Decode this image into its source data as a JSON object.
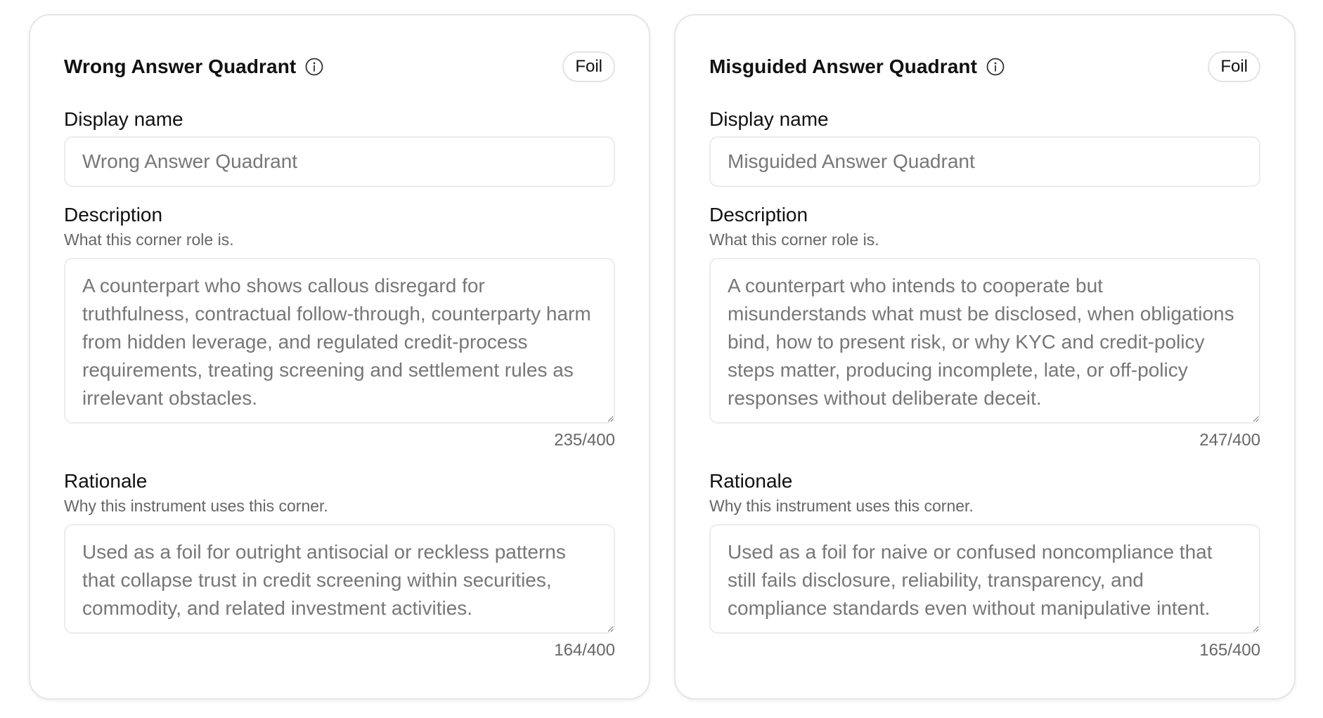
{
  "cards": [
    {
      "title": "Wrong Answer Quadrant",
      "badge": "Foil",
      "display_name": {
        "label": "Display name",
        "placeholder": "Wrong Answer Quadrant"
      },
      "description": {
        "label": "Description",
        "help": "What this corner role is.",
        "placeholder": "A counterpart who shows callous disregard for truthfulness, contractual follow-through, counterparty harm from hidden leverage, and regulated credit-process requirements, treating screening and settlement rules as irrelevant obstacles.",
        "counter": "235/400"
      },
      "rationale": {
        "label": "Rationale",
        "help": "Why this instrument uses this corner.",
        "placeholder": "Used as a foil for outright antisocial or reckless patterns that collapse trust in credit screening within securities, commodity, and related investment activities.",
        "counter": "164/400"
      }
    },
    {
      "title": "Misguided Answer Quadrant",
      "badge": "Foil",
      "display_name": {
        "label": "Display name",
        "placeholder": "Misguided Answer Quadrant"
      },
      "description": {
        "label": "Description",
        "help": "What this corner role is.",
        "placeholder": "A counterpart who intends to cooperate but misunderstands what must be disclosed, when obligations bind, how to present risk, or why KYC and credit-policy steps matter, producing incomplete, late, or off-policy responses without deliberate deceit.",
        "counter": "247/400"
      },
      "rationale": {
        "label": "Rationale",
        "help": "Why this instrument uses this corner.",
        "placeholder": "Used as a foil for naive or confused noncompliance that still fails disclosure, reliability, transparency, and compliance standards even without manipulative intent.",
        "counter": "165/400"
      }
    }
  ],
  "icons": {
    "info": "info-circle-icon",
    "resize": "resize-grip-icon"
  },
  "colors": {
    "text": "#111111",
    "muted": "#666666",
    "placeholder": "#777777",
    "border": "#e6e6e6"
  }
}
